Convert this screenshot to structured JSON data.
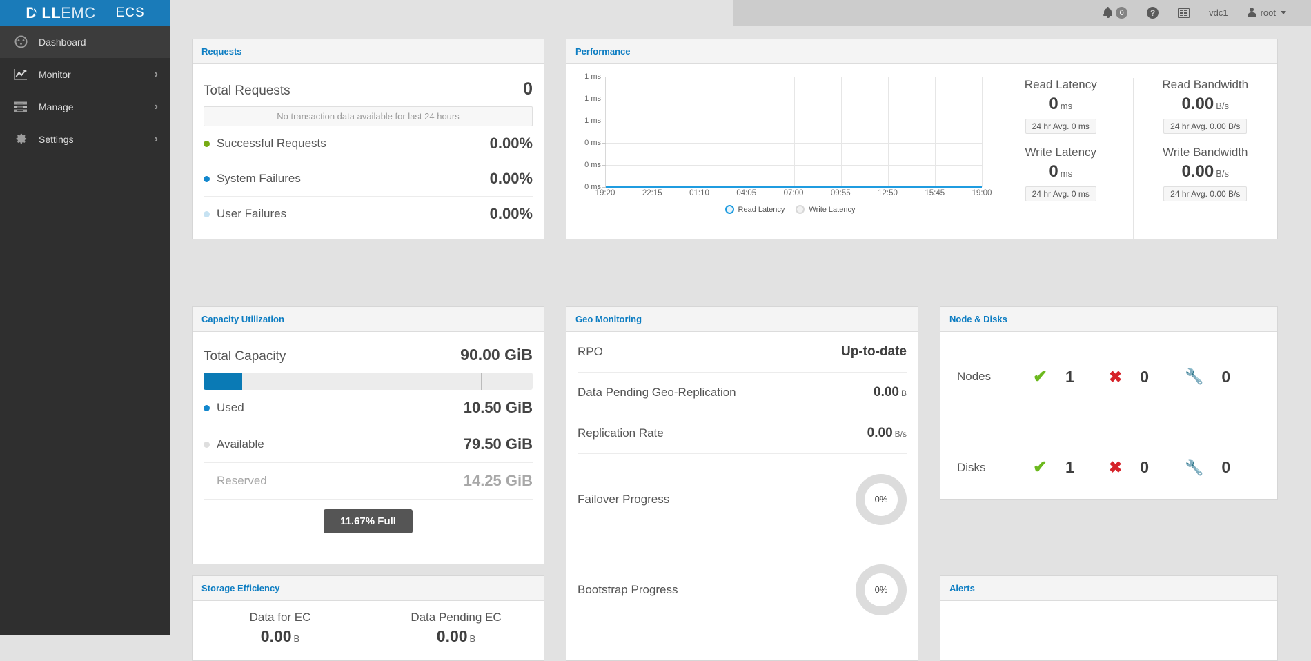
{
  "brand": {
    "dell": "D LL",
    "emc": "EMC",
    "product": "ECS"
  },
  "topbar": {
    "alerts_badge": "0",
    "vdc": "vdc1",
    "user": "root"
  },
  "sidebar": {
    "items": [
      {
        "label": "Dashboard",
        "icon": "dashboard-icon",
        "chevron": "",
        "active": true
      },
      {
        "label": "Monitor",
        "icon": "monitor-chart-icon",
        "chevron": "›",
        "active": false
      },
      {
        "label": "Manage",
        "icon": "manage-server-icon",
        "chevron": "›",
        "active": false
      },
      {
        "label": "Settings",
        "icon": "gear-icon",
        "chevron": "›",
        "active": false
      }
    ]
  },
  "requests": {
    "title": "Requests",
    "total_label": "Total Requests",
    "total_value": "0",
    "no_data_message": "No transaction data available for last 24 hours",
    "rows": [
      {
        "label": "Successful Requests",
        "value": "0.00%",
        "color": "#77ab14"
      },
      {
        "label": "System Failures",
        "value": "0.00%",
        "color": "#1287cd"
      },
      {
        "label": "User Failures",
        "value": "0.00%",
        "color": "#c6e2f2"
      }
    ]
  },
  "performance": {
    "title": "Performance",
    "stats": [
      {
        "label": "Read Latency",
        "value": "0",
        "unit": "ms",
        "avg": "24 hr Avg. 0 ms"
      },
      {
        "label": "Write Latency",
        "value": "0",
        "unit": "ms",
        "avg": "24 hr Avg. 0 ms"
      },
      {
        "label": "Read Bandwidth",
        "value": "0.00",
        "unit": "B/s",
        "avg": "24 hr Avg. 0.00 B/s"
      },
      {
        "label": "Write Bandwidth",
        "value": "0.00",
        "unit": "B/s",
        "avg": "24 hr Avg. 0.00 B/s"
      }
    ]
  },
  "chart_data": {
    "type": "line",
    "title": "Performance",
    "xlabel": "",
    "ylabel": "",
    "x": [
      "19:20",
      "22:15",
      "01:10",
      "04:05",
      "07:00",
      "09:55",
      "12:50",
      "15:45",
      "19:00"
    ],
    "ytick_labels": [
      "1 ms",
      "1 ms",
      "1 ms",
      "0 ms",
      "0 ms",
      "0 ms"
    ],
    "ylim": [
      0,
      1
    ],
    "grid": true,
    "legend_position": "bottom",
    "series": [
      {
        "name": "Read Latency",
        "color": "#1f9ce0",
        "values": [
          0,
          0,
          0,
          0,
          0,
          0,
          0,
          0,
          0
        ]
      },
      {
        "name": "Write Latency",
        "color": "#e0e0e0",
        "values": [
          0,
          0,
          0,
          0,
          0,
          0,
          0,
          0,
          0
        ]
      }
    ]
  },
  "capacity": {
    "title": "Capacity Utilization",
    "total_label": "Total Capacity",
    "total_value": "90.00 GiB",
    "used_percent": 11.67,
    "reserved_percent": 84.2,
    "rows": [
      {
        "label": "Used",
        "value": "10.50 GiB",
        "color": "#1287cd",
        "muted": false
      },
      {
        "label": "Available",
        "value": "79.50 GiB",
        "color": "#dedede",
        "muted": false
      },
      {
        "label": "Reserved",
        "value": "14.25 GiB",
        "color": "",
        "muted": true
      }
    ],
    "full_badge": "11.67% Full"
  },
  "storage_efficiency": {
    "title": "Storage Efficiency",
    "columns": [
      {
        "label": "Data for EC",
        "value": "0.00",
        "unit": "B"
      },
      {
        "label": "Data Pending EC",
        "value": "0.00",
        "unit": "B"
      }
    ]
  },
  "geo": {
    "title": "Geo Monitoring",
    "rows": [
      {
        "label": "RPO",
        "value": "Up-to-date",
        "unit": ""
      },
      {
        "label": "Data Pending Geo-Replication",
        "value": "0.00",
        "unit": "B"
      },
      {
        "label": "Replication Rate",
        "value": "0.00",
        "unit": "B/s"
      }
    ],
    "progress": [
      {
        "label": "Failover Progress",
        "value": "0%"
      },
      {
        "label": "Bootstrap Progress",
        "value": "0%"
      }
    ]
  },
  "nodes_disks": {
    "title": "Node & Disks",
    "rows": [
      {
        "label": "Nodes",
        "good": "1",
        "bad": "0",
        "maintenance": "0"
      },
      {
        "label": "Disks",
        "good": "1",
        "bad": "0",
        "maintenance": "0"
      }
    ]
  },
  "alerts": {
    "title": "Alerts"
  }
}
